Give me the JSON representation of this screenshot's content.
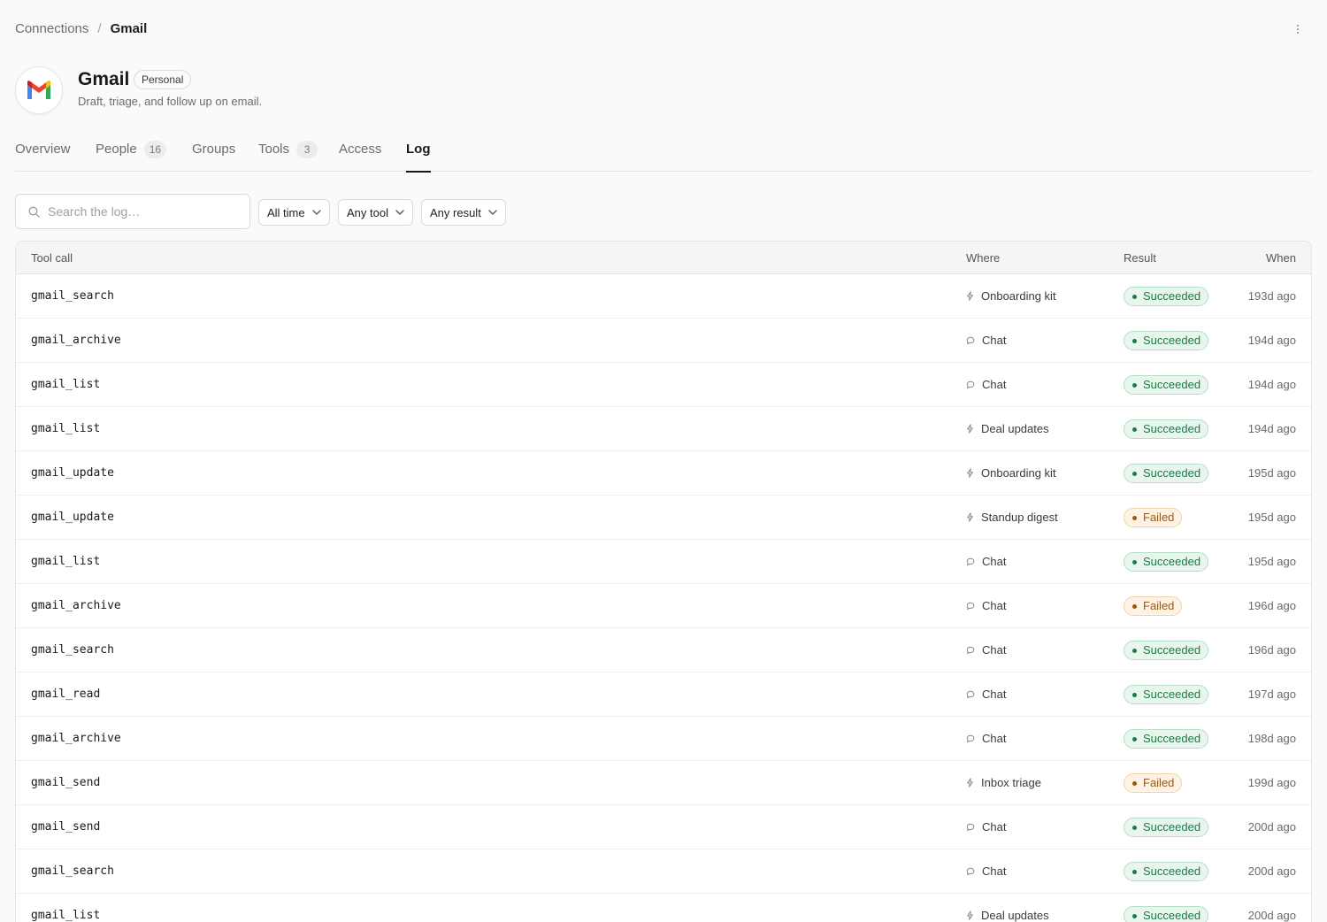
{
  "breadcrumb": {
    "parent": "Connections",
    "separator": "/",
    "current": "Gmail"
  },
  "header": {
    "title": "Gmail",
    "badge": "Personal",
    "description": "Draft, triage, and follow up on email.",
    "logo_icon": "gmail-logo"
  },
  "tabs": [
    {
      "label": "Overview",
      "count": null,
      "active": false
    },
    {
      "label": "People",
      "count": "16",
      "active": false
    },
    {
      "label": "Groups",
      "count": null,
      "active": false
    },
    {
      "label": "Tools",
      "count": "3",
      "active": false
    },
    {
      "label": "Access",
      "count": null,
      "active": false
    },
    {
      "label": "Log",
      "count": null,
      "active": true
    }
  ],
  "filters": {
    "search_placeholder": "Search the log…",
    "time": "All time",
    "tool": "Any tool",
    "result": "Any result"
  },
  "table": {
    "columns": {
      "tool": "Tool call",
      "where": "Where",
      "result": "Result",
      "when": "When"
    },
    "rows": [
      {
        "tool": "gmail_search",
        "where": "Onboarding kit",
        "where_icon": "automation-icon",
        "result": "Succeeded",
        "status": "ok",
        "when": "193d ago"
      },
      {
        "tool": "gmail_archive",
        "where": "Chat",
        "where_icon": "chat-icon",
        "result": "Succeeded",
        "status": "ok",
        "when": "194d ago"
      },
      {
        "tool": "gmail_list",
        "where": "Chat",
        "where_icon": "chat-icon",
        "result": "Succeeded",
        "status": "ok",
        "when": "194d ago"
      },
      {
        "tool": "gmail_list",
        "where": "Deal updates",
        "where_icon": "automation-icon",
        "result": "Succeeded",
        "status": "ok",
        "when": "194d ago"
      },
      {
        "tool": "gmail_update",
        "where": "Onboarding kit",
        "where_icon": "automation-icon",
        "result": "Succeeded",
        "status": "ok",
        "when": "195d ago"
      },
      {
        "tool": "gmail_update",
        "where": "Standup digest",
        "where_icon": "automation-icon",
        "result": "Failed",
        "status": "fail",
        "when": "195d ago"
      },
      {
        "tool": "gmail_list",
        "where": "Chat",
        "where_icon": "chat-icon",
        "result": "Succeeded",
        "status": "ok",
        "when": "195d ago"
      },
      {
        "tool": "gmail_archive",
        "where": "Chat",
        "where_icon": "chat-icon",
        "result": "Failed",
        "status": "fail",
        "when": "196d ago"
      },
      {
        "tool": "gmail_search",
        "where": "Chat",
        "where_icon": "chat-icon",
        "result": "Succeeded",
        "status": "ok",
        "when": "196d ago"
      },
      {
        "tool": "gmail_read",
        "where": "Chat",
        "where_icon": "chat-icon",
        "result": "Succeeded",
        "status": "ok",
        "when": "197d ago"
      },
      {
        "tool": "gmail_archive",
        "where": "Chat",
        "where_icon": "chat-icon",
        "result": "Succeeded",
        "status": "ok",
        "when": "198d ago"
      },
      {
        "tool": "gmail_send",
        "where": "Inbox triage",
        "where_icon": "automation-icon",
        "result": "Failed",
        "status": "fail",
        "when": "199d ago"
      },
      {
        "tool": "gmail_send",
        "where": "Chat",
        "where_icon": "chat-icon",
        "result": "Succeeded",
        "status": "ok",
        "when": "200d ago"
      },
      {
        "tool": "gmail_search",
        "where": "Chat",
        "where_icon": "chat-icon",
        "result": "Succeeded",
        "status": "ok",
        "when": "200d ago"
      },
      {
        "tool": "gmail_list",
        "where": "Deal updates",
        "where_icon": "automation-icon",
        "result": "Succeeded",
        "status": "ok",
        "when": "200d ago"
      }
    ]
  },
  "colors": {
    "success": "#1f7a48",
    "failure": "#9a5a12",
    "text": "#1f1f1f",
    "muted": "#6b6b6b"
  }
}
